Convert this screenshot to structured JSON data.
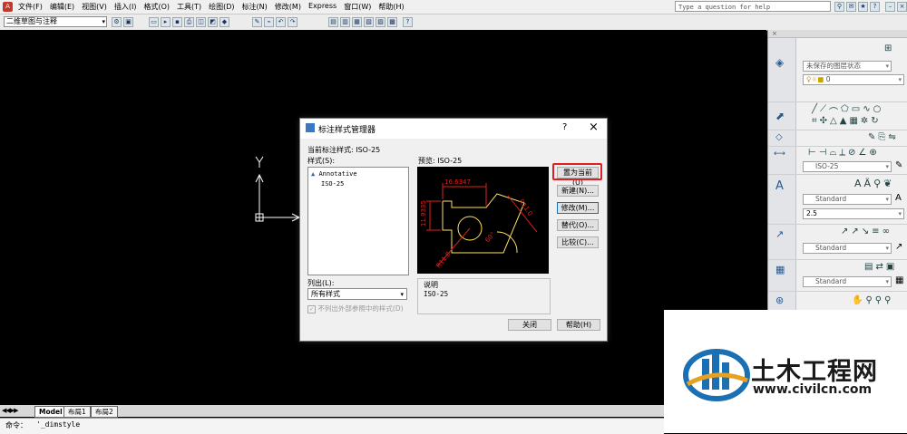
{
  "menubar": {
    "items": [
      "文件(F)",
      "编辑(E)",
      "视图(V)",
      "插入(I)",
      "格式(O)",
      "工具(T)",
      "绘图(D)",
      "标注(N)",
      "修改(M)",
      "Express",
      "窗口(W)",
      "帮助(H)"
    ],
    "help_placeholder": "Type a question for help"
  },
  "toolbar": {
    "workspace": "二维草图与注释"
  },
  "canvas": {
    "ucs_y_label": "Y"
  },
  "layout_tabs": [
    "Model",
    "布局1",
    "布局2"
  ],
  "command_line": {
    "prompt": "命令：",
    "text": "'_dimstyle"
  },
  "palette": {
    "layer_state": "未保存的图层状态",
    "layer_name": "0",
    "dim_style": "ISO-25",
    "text_style": "Standard",
    "text_height": "2.5",
    "mleader_style": "Standard",
    "table_style": "Standard"
  },
  "dialog": {
    "title": "标注样式管理器",
    "help_btn": "?",
    "close_btn": "×",
    "current_style_label": "当前标注样式: ISO-25",
    "styles_label": "样式(S):",
    "styles": [
      "Annotative",
      "ISO-25"
    ],
    "preview_label": "预览: ISO-25",
    "list_label": "列出(L):",
    "list_value": "所有样式",
    "checkbox_label": "不列出外部参照中的样式(D)",
    "desc_label": "说明",
    "desc_value": "ISO-25",
    "buttons": {
      "set_current": "置为当前(U)",
      "new": "新建(N)...",
      "modify": "修改(M)...",
      "override": "替代(O)...",
      "compare": "比较(C)...",
      "close": "关闭",
      "help": "帮助(H)"
    },
    "preview_dims": {
      "top": "16.6347",
      "left": "11.9335",
      "right": "R11.0",
      "angle": "60°",
      "radius": "R11.8"
    }
  },
  "watermark": {
    "brand": "土木工程网",
    "url": "www.civilcn.com"
  },
  "colors": {
    "highlight": "#e02020",
    "accent": "#1b6fb3"
  }
}
